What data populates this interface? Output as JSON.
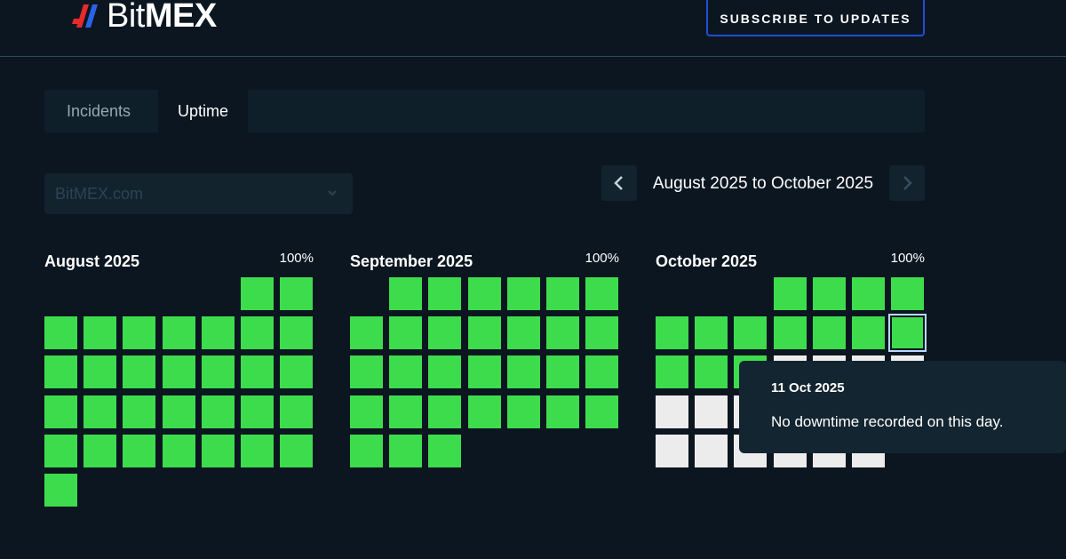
{
  "header": {
    "logo_text_thin": "Bit",
    "logo_text_bold": "MEX",
    "subscribe_label": "SUBSCRIBE TO UPDATES"
  },
  "tabs": [
    {
      "label": "Incidents",
      "active": false
    },
    {
      "label": "Uptime",
      "active": true
    }
  ],
  "component_select": {
    "value": "BitMEX.com",
    "icon": "chevron-down-icon"
  },
  "range": {
    "label": "August 2025 to October 2025",
    "prev_icon": "chevron-left-icon",
    "next_icon": "chevron-right-icon"
  },
  "months": [
    {
      "name": "August 2025",
      "uptime": "100%",
      "first_weekday": 5,
      "days": 31,
      "recorded_days": 31,
      "selected_day": null
    },
    {
      "name": "September 2025",
      "uptime": "100%",
      "first_weekday": 1,
      "days": 30,
      "recorded_days": 30,
      "selected_day": null
    },
    {
      "name": "October 2025",
      "uptime": "100%",
      "first_weekday": 3,
      "days": 31,
      "recorded_days": 14,
      "selected_day": 11
    }
  ],
  "tooltip": {
    "date": "11 Oct 2025",
    "message": "No downtime recorded on this day."
  },
  "colors": {
    "background": "#0b1620",
    "uptime_ok": "#3ddc4d",
    "future_day": "#ececec",
    "subscribe_border": "#1f4fd6",
    "logo_red": "#e52b2b",
    "logo_blue": "#2a63e6"
  }
}
